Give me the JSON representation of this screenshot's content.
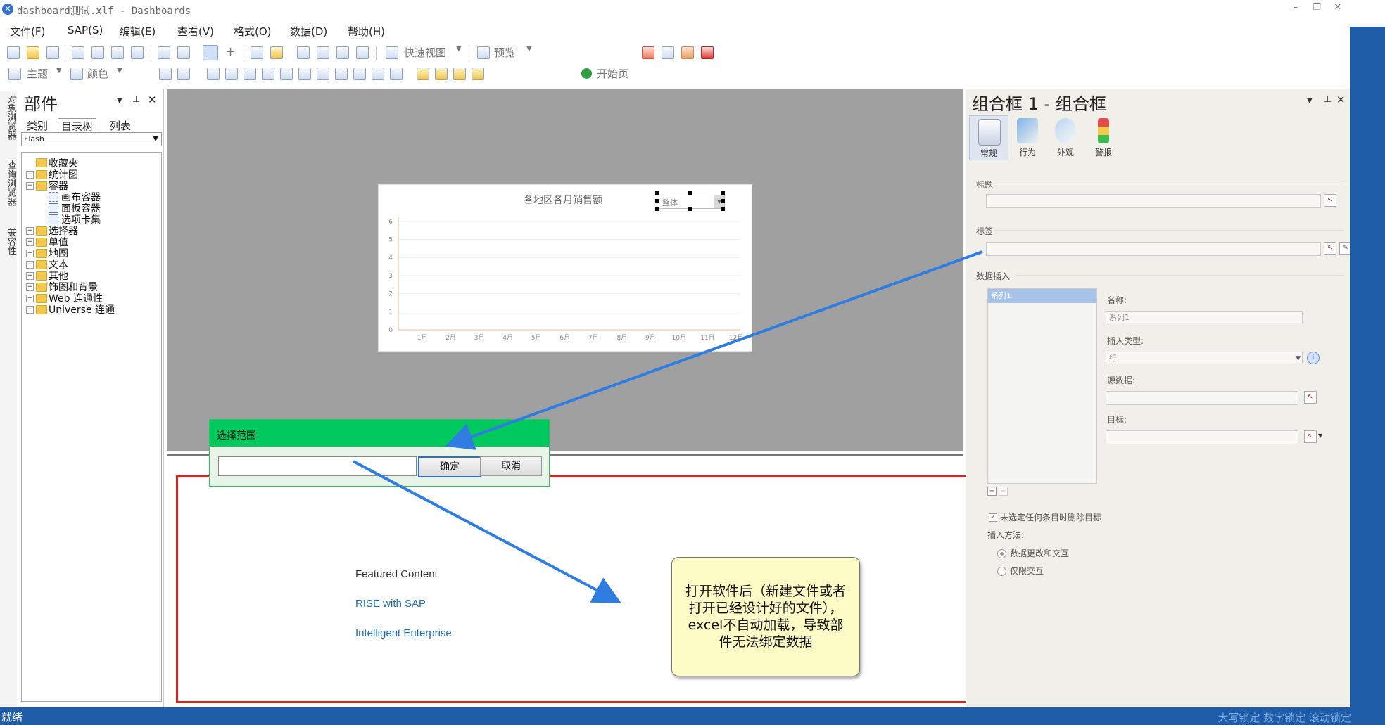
{
  "window": {
    "title": "dashboard测试.xlf - Dashboards",
    "minimize": "–",
    "restore": "❐",
    "close": "✕"
  },
  "menu": {
    "items": [
      "文件(F)",
      "SAP(S)",
      "编辑(E)",
      "查看(V)",
      "格式(O)",
      "数据(D)",
      "帮助(H)"
    ]
  },
  "toolbar": {
    "quick_view": "快速视图",
    "preview": "预览",
    "theme": "主题",
    "color": "颜色",
    "start_page": "开始页"
  },
  "left_tabs": [
    "对象浏览器",
    "查询浏览器",
    "兼容性"
  ],
  "components_panel": {
    "title": "部件",
    "tabs": [
      "类别",
      "目录树",
      "列表"
    ],
    "filter": "Flash",
    "tree": [
      {
        "label": "收藏夹",
        "expandable": false,
        "level": 0
      },
      {
        "label": "统计图",
        "expandable": true,
        "level": 0
      },
      {
        "label": "容器",
        "expandable": true,
        "expanded": true,
        "level": 0
      },
      {
        "label": "画布容器",
        "level": 1
      },
      {
        "label": "面板容器",
        "level": 1
      },
      {
        "label": "选项卡集",
        "level": 1
      },
      {
        "label": "选择器",
        "expandable": true,
        "level": 0
      },
      {
        "label": "单值",
        "expandable": true,
        "level": 0
      },
      {
        "label": "地图",
        "expandable": true,
        "level": 0
      },
      {
        "label": "文本",
        "expandable": true,
        "level": 0
      },
      {
        "label": "其他",
        "expandable": true,
        "level": 0
      },
      {
        "label": "饰图和背景",
        "expandable": true,
        "level": 0
      },
      {
        "label": "Web 连通性",
        "expandable": true,
        "level": 0
      },
      {
        "label": "Universe 连通",
        "expandable": true,
        "level": 0
      }
    ]
  },
  "chart": {
    "combo_value": "整体"
  },
  "chart_data": {
    "type": "line",
    "title": "各地区各月销售额",
    "categories": [
      "1月",
      "2月",
      "3月",
      "4月",
      "5月",
      "6月",
      "7月",
      "8月",
      "9月",
      "10月",
      "11月",
      "12月"
    ],
    "y_ticks": [
      "0",
      "1",
      "2",
      "3",
      "4",
      "5",
      "6"
    ],
    "ylim": [
      0,
      6
    ],
    "series": [],
    "grid": true
  },
  "dialog": {
    "title": "选择范围",
    "input_value": "",
    "ok": "确定",
    "cancel": "取消"
  },
  "lower_area": {
    "featured": "Featured Content",
    "links": [
      "RISE with SAP",
      "Intelligent Enterprise"
    ],
    "note": "打开软件后（新建文件或者打开已经设计好的文件），excel不自动加载，导致部件无法绑定数据"
  },
  "properties_panel": {
    "title": "组合框 1 - 组合框",
    "tools": [
      "常规",
      "行为",
      "外观",
      "警报"
    ],
    "title_label": "标题",
    "label_label": "标签",
    "data_insert_label": "数据插入",
    "series_item": "系列1",
    "name_label": "名称:",
    "name_value": "系列1",
    "insert_type_label": "插入类型:",
    "insert_type_value": "行",
    "source_label": "源数据:",
    "target_label": "目标:",
    "clear_checkbox": "未选定任何条目时删除目标",
    "insert_method_label": "插入方法:",
    "method_options": [
      "数据更改和交互",
      "仅限交互"
    ]
  },
  "statusbar": {
    "status": "就绪",
    "locks": "大写锁定  数字锁定  滚动锁定"
  }
}
